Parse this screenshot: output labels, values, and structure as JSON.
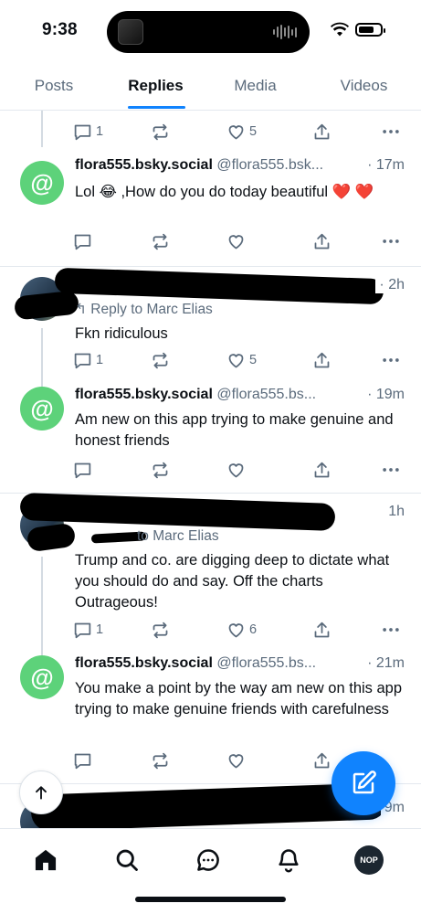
{
  "status_bar": {
    "time": "9:38"
  },
  "tabs": [
    "Posts",
    "Replies",
    "Media",
    "Videos"
  ],
  "posts": [
    {
      "kind": "stats-only",
      "counts": {
        "reply": "1",
        "repost": "",
        "like": "5"
      }
    },
    {
      "kind": "self",
      "avatar_glyph": "@",
      "name": "flora555.bsky.social",
      "handle": "@flora555.bsk...",
      "ago": "· 17m",
      "text": "Lol 😂 ,How do you do today beautiful ❤️ ❤️",
      "counts": {
        "reply": "",
        "repost": "",
        "like": ""
      }
    },
    {
      "kind": "other",
      "ago": "· 2h",
      "reply_to": "Reply to Marc Elias",
      "text": "Fkn ridiculous",
      "counts": {
        "reply": "1",
        "repost": "",
        "like": "5"
      }
    },
    {
      "kind": "self",
      "avatar_glyph": "@",
      "name": "flora555.bsky.social",
      "handle": "@flora555.bs...",
      "ago": "· 19m",
      "text": "Am new on this app trying to make genuine and honest friends",
      "counts": {
        "reply": "",
        "repost": "",
        "like": ""
      }
    },
    {
      "kind": "other",
      "ago": "1h",
      "reply_to": "to Marc Elias",
      "text": "Trump and co. are digging deep to dictate what you should do and say. Off the charts Outrageous!",
      "counts": {
        "reply": "1",
        "repost": "",
        "like": "6"
      }
    },
    {
      "kind": "self",
      "avatar_glyph": "@",
      "name": "flora555.bsky.social",
      "handle": "@flora555.bs...",
      "ago": "· 21m",
      "text": "You make a point by the way am new on this app trying to make genuine friends with carefulness",
      "counts": {
        "reply": "",
        "repost": "",
        "like": ""
      }
    },
    {
      "kind": "other-partial",
      "ago": "9m"
    }
  ],
  "icons": {
    "reply": "comment-icon",
    "repost": "repost-icon",
    "like": "heart-icon",
    "share": "share-icon",
    "more": "more-dots-icon"
  },
  "nav": [
    "home-icon",
    "search-icon",
    "chat-icon",
    "notifications-icon",
    "profile-avatar"
  ],
  "profile_avatar_text": "NOP",
  "colors": {
    "accent": "#1083fe",
    "avatar_green": "#5dd27a",
    "muted": "#5b6b7c"
  }
}
